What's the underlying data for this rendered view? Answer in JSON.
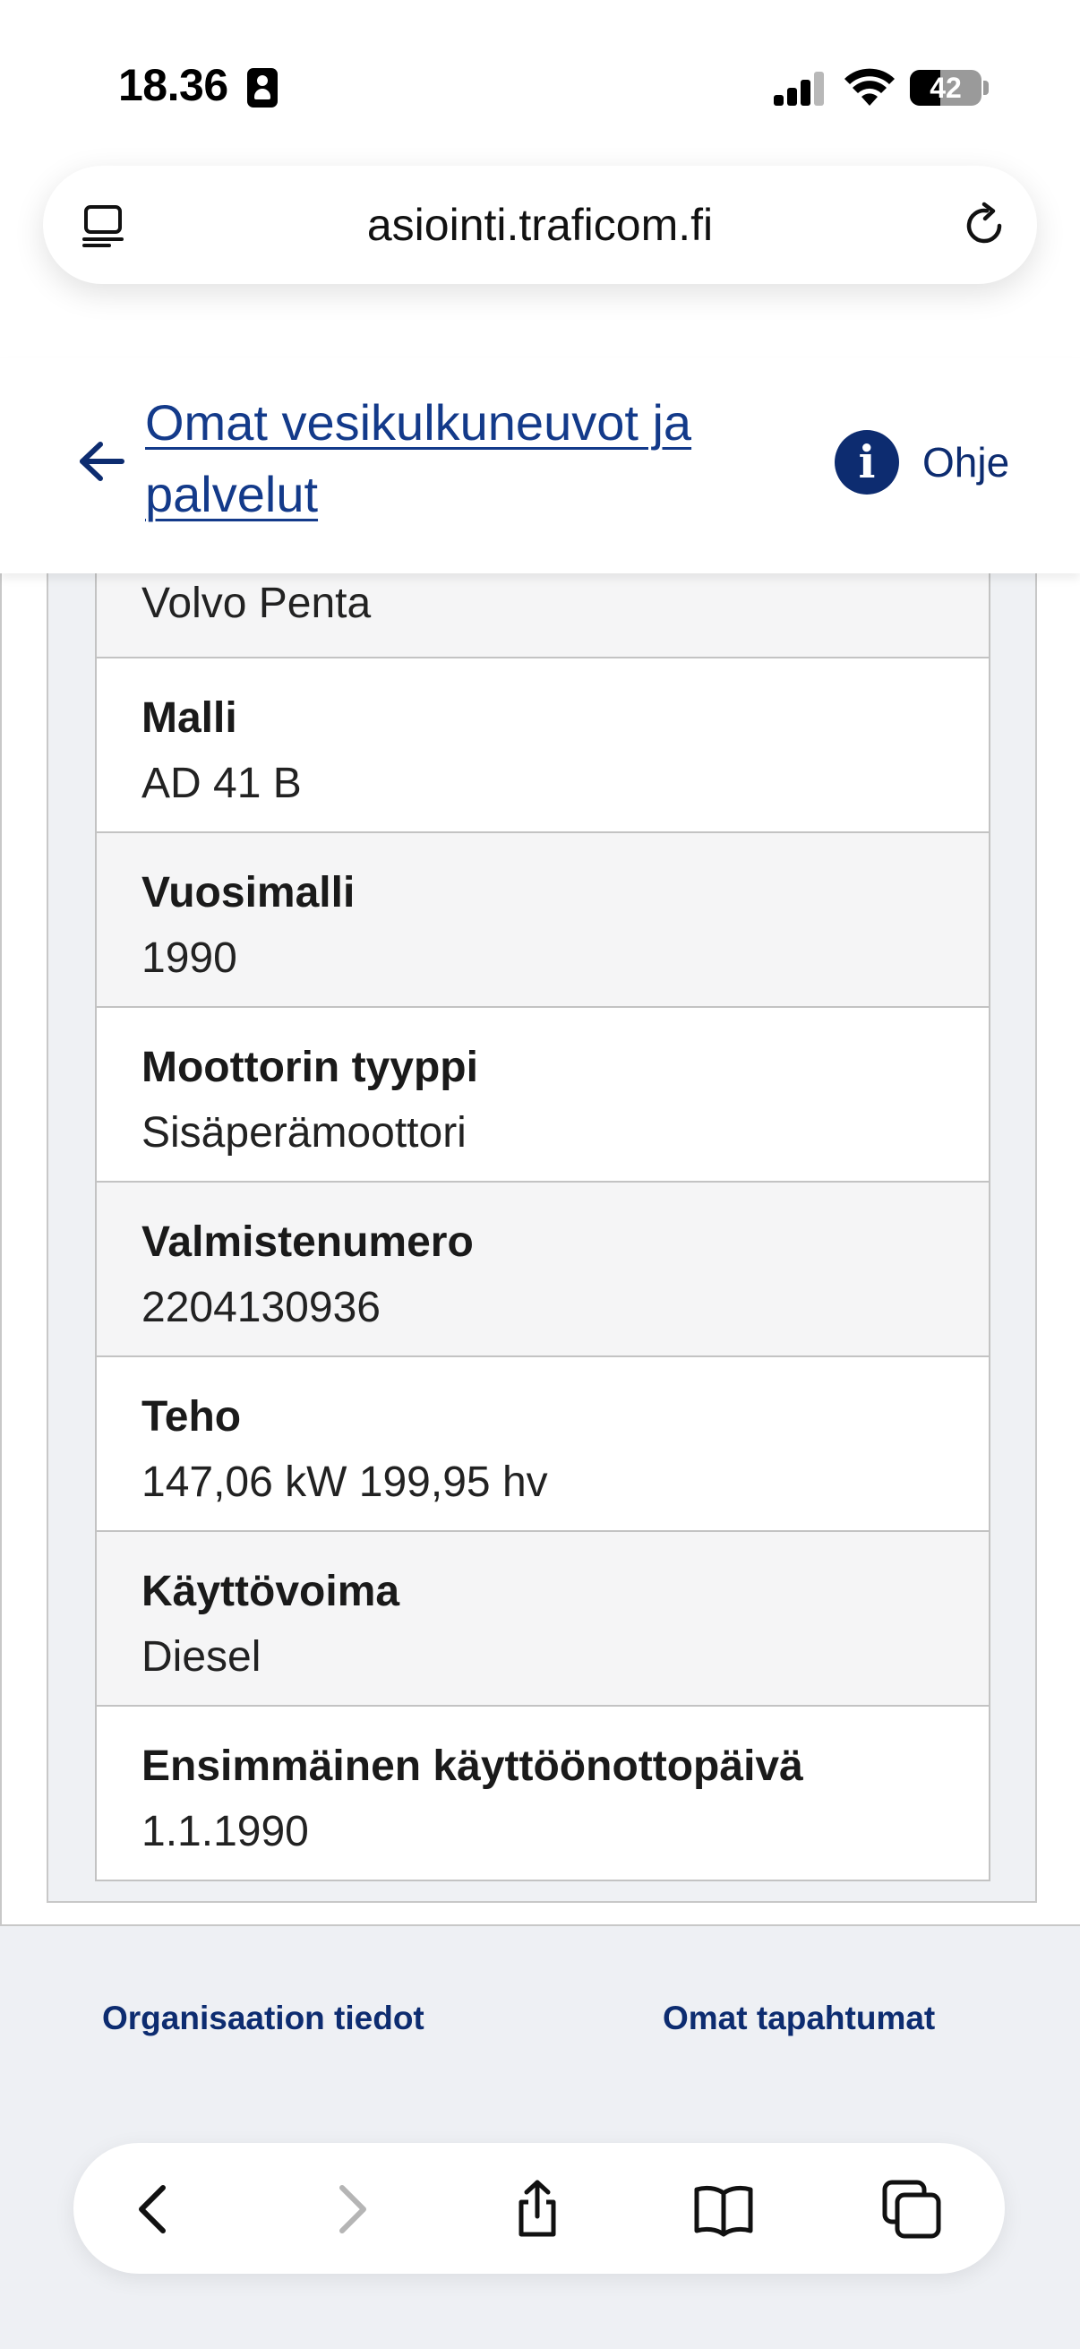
{
  "status_bar": {
    "time": "18.36",
    "battery_percent": "42",
    "battery_level": 0.42
  },
  "browser": {
    "url": "asiointi.traficom.fi"
  },
  "header": {
    "back_link": "Omat vesikulkuneuvot ja palvelut",
    "help_label": "Ohje",
    "info_glyph": "i"
  },
  "details": {
    "manufacturer_value": "Volvo Penta",
    "rows": [
      {
        "label": "Malli",
        "value": "AD 41 B"
      },
      {
        "label": "Vuosimalli",
        "value": "1990"
      },
      {
        "label": "Moottorin tyyppi",
        "value": "Sisäperämoottori"
      },
      {
        "label": "Valmistenumero",
        "value": "2204130936"
      },
      {
        "label": "Teho",
        "value": "147,06 kW 199,95 hv"
      },
      {
        "label": "Käyttövoima",
        "value": "Diesel"
      },
      {
        "label": "Ensimmäinen käyttöönottopäivä",
        "value": "1.1.1990"
      }
    ]
  },
  "footer": {
    "organisation_link": "Organisaation tiedot",
    "events_link": "Omat tapahtumat"
  },
  "toolbar": {
    "icons": [
      "back-icon",
      "forward-icon",
      "share-icon",
      "bookmarks-icon",
      "tabs-icon"
    ]
  },
  "colors": {
    "link": "#133a8a",
    "brand_navy": "#0d2c70",
    "page_bg": "#eef0f4"
  }
}
